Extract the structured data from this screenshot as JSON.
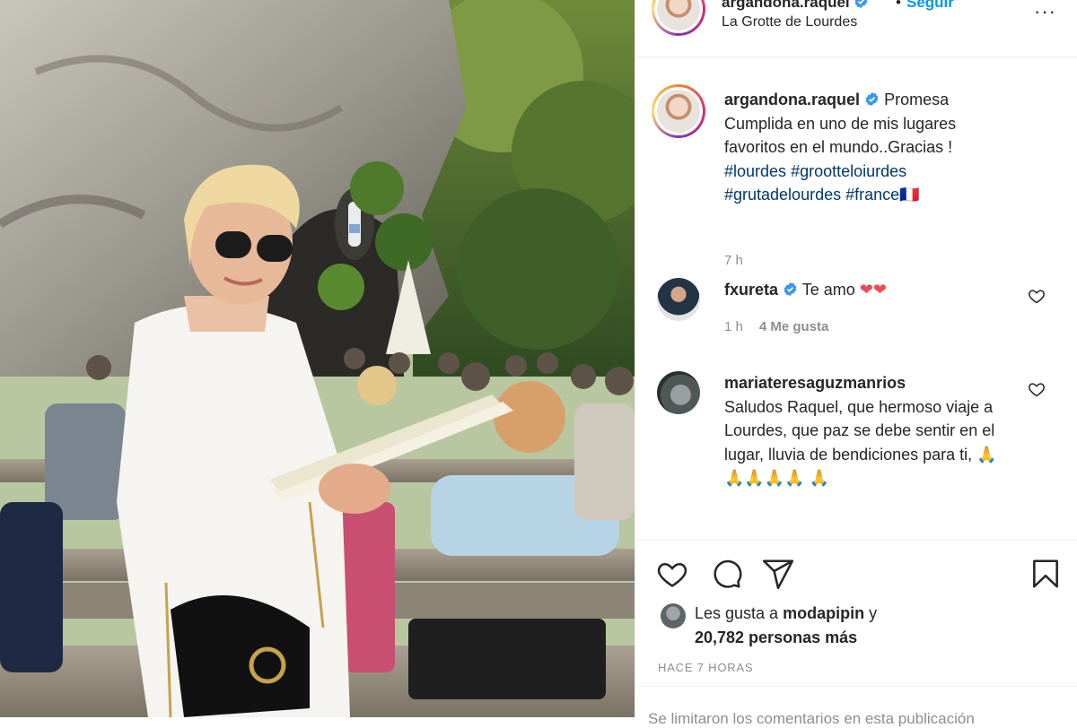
{
  "post": {
    "username": "argandona.raquel",
    "follow_label": "Seguir",
    "separator": "•",
    "location": "La Grotte de Lourdes",
    "more_label": "···"
  },
  "caption": {
    "username": "argandona.raquel",
    "text": "Promesa Cumplida en uno de mis lugares favoritos en el mundo..Gracias !",
    "hashtags": [
      "#lourdes",
      "#grootteloiurdes",
      "#grutadelourdes",
      "#france"
    ],
    "flag": "🇫🇷",
    "time": "7 h"
  },
  "comments": [
    {
      "username": "fxureta",
      "verified": true,
      "text": "Te amo",
      "emoji": "❤❤",
      "time": "1 h",
      "likes": "4 Me gusta"
    },
    {
      "username": "mariateresaguzmanrios",
      "verified": false,
      "text": "Saludos Raquel, que hermoso viaje a Lourdes, que paz se debe sentir en el lugar, lluvia de bendiciones para ti,",
      "emoji": "🙏🙏🙏🙏🙏 🙏"
    }
  ],
  "likes": {
    "prefix": "Les gusta a",
    "user": "modapipin",
    "conj": "y",
    "count": "20,782 personas más"
  },
  "time_ago": "HACE 7 HORAS",
  "add_comment": "Se limitaron los comentarios en esta publicación",
  "icons": {
    "verified": "verified-badge-icon",
    "like": "heart-icon",
    "comment": "comment-bubble-icon",
    "share": "paper-plane-icon",
    "save": "bookmark-icon",
    "more": "more-dots-icon"
  },
  "colors": {
    "link_blue": "#0095f6",
    "hashtag": "#00376b",
    "verified": "#3897f0",
    "muted": "#8e8e8e",
    "heart_red": "#ed4956"
  }
}
